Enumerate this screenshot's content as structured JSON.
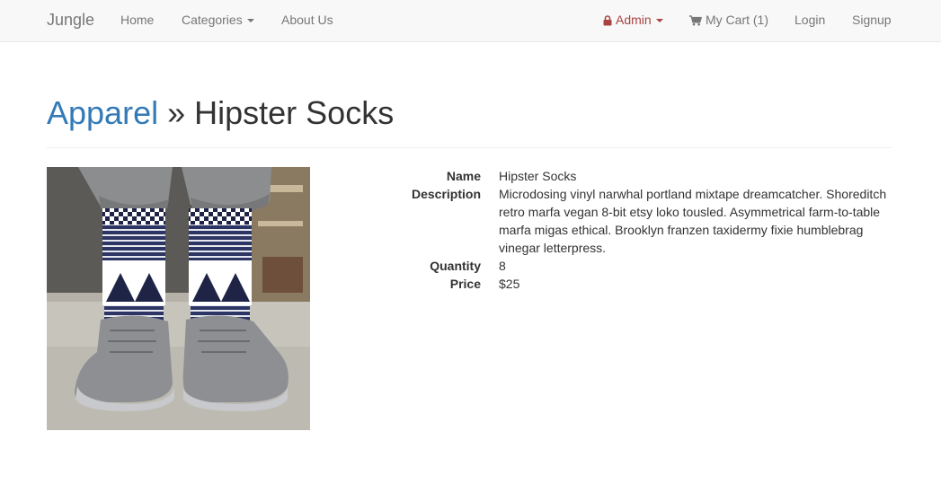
{
  "nav": {
    "brand": "Jungle",
    "home": "Home",
    "categories": "Categories",
    "about": "About Us",
    "admin": "Admin",
    "cart": "My Cart (1)",
    "login": "Login",
    "signup": "Signup",
    "admin_icon": "lock-icon",
    "cart_icon": "shopping-cart-icon"
  },
  "header": {
    "category": "Apparel",
    "separator": " » ",
    "product": "Hipster Socks"
  },
  "product": {
    "labels": {
      "name": "Name",
      "description": "Description",
      "quantity": "Quantity",
      "price": "Price"
    },
    "name": "Hipster Socks",
    "description": "Microdosing vinyl narwhal portland mixtape dreamcatcher. Shoreditch retro marfa vegan 8-bit etsy loko tousled. Asymmetrical farm-to-table marfa migas ethical. Brooklyn franzen taxidermy fixie humblebrag vinegar letterpress.",
    "quantity": "8",
    "price": "$25"
  },
  "colors": {
    "navbar_bg": "#f8f8f8",
    "link": "#337ab7",
    "admin": "#a94442",
    "nav_text": "#777777"
  }
}
